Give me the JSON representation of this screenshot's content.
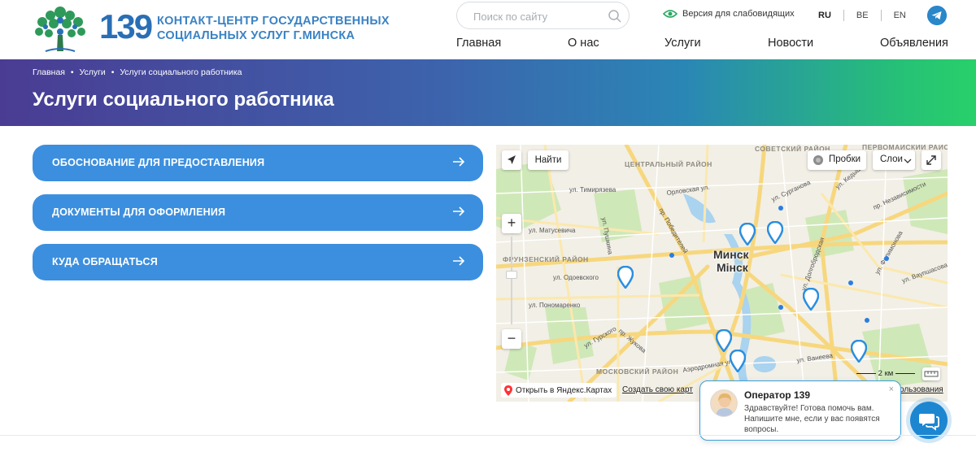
{
  "header": {
    "logo_number": "139",
    "logo_text_line1": "КОНТАКТ-ЦЕНТР ГОСУДАРСТВЕННЫХ",
    "logo_text_line2": "СОЦИАЛЬНЫХ УСЛУГ Г.МИНСКА",
    "search_placeholder": "Поиск по сайту",
    "vision_label": "Версия для слабовидящих",
    "languages": [
      "RU",
      "BE",
      "EN"
    ],
    "active_language": "RU",
    "nav": [
      "Главная",
      "О нас",
      "Услуги",
      "Новости",
      "Объявления"
    ]
  },
  "banner": {
    "breadcrumbs": [
      "Главная",
      "Услуги",
      "Услуги социального работника"
    ],
    "breadcrumb_sep": "•",
    "title": "Услуги социального работника"
  },
  "accordion": [
    {
      "label": "ОБОСНОВАНИЕ ДЛЯ ПРЕДОСТАВЛЕНИЯ"
    },
    {
      "label": "ДОКУМЕНТЫ ДЛЯ ОФОРМЛЕНИЯ"
    },
    {
      "label": "КУДА ОБРАЩАТЬСЯ"
    }
  ],
  "map": {
    "find_label": "Найти",
    "traffic_label": "Пробки",
    "layers_label": "Слои",
    "city_label_1": "Минск",
    "city_label_2": "Мінск",
    "open_in_maps": "Открыть в Яндекс.Картах",
    "create_map": "Создать свою карт",
    "terms": "ользования",
    "scale": "2 км",
    "district_labels": [
      "ЦЕНТРАЛЬНЫЙ РАЙОН",
      "СОВЕТСКИЙ РАЙОН",
      "ФРУНЗЕНСКИЙ РАЙОН",
      "МОСКОВСКИЙ РАЙОН",
      "ПЕРВОМАЙСКИЙ РАЙОН"
    ],
    "street_labels": [
      "ул. Тимирязева",
      "Орловская ул.",
      "ул. Сурганова",
      "пр. Независимости",
      "ул. Матусевича",
      "ул. Одоевского",
      "ул. Пономаренко",
      "пр. Победителей",
      "ул. Пушкина",
      "ул. Ванеева",
      "Аэродромная ул.",
      "ул. Гурского",
      "пр. Жукова",
      "ул. Филимонова",
      "ул. Кедышко",
      "ул. Ваупшасова",
      "ул. Долгобродская"
    ]
  },
  "chat": {
    "operator_name": "Оператор 139",
    "message": "Здравствуйте! Готова помочь вам. Напишите мне, если у вас появятся вопросы.",
    "close": "×"
  },
  "colors": {
    "accent_blue": "#3c8fde",
    "logo_blue": "#3a82c4",
    "brand_green": "#28d06a",
    "banner_purple": "#4a3c93"
  }
}
